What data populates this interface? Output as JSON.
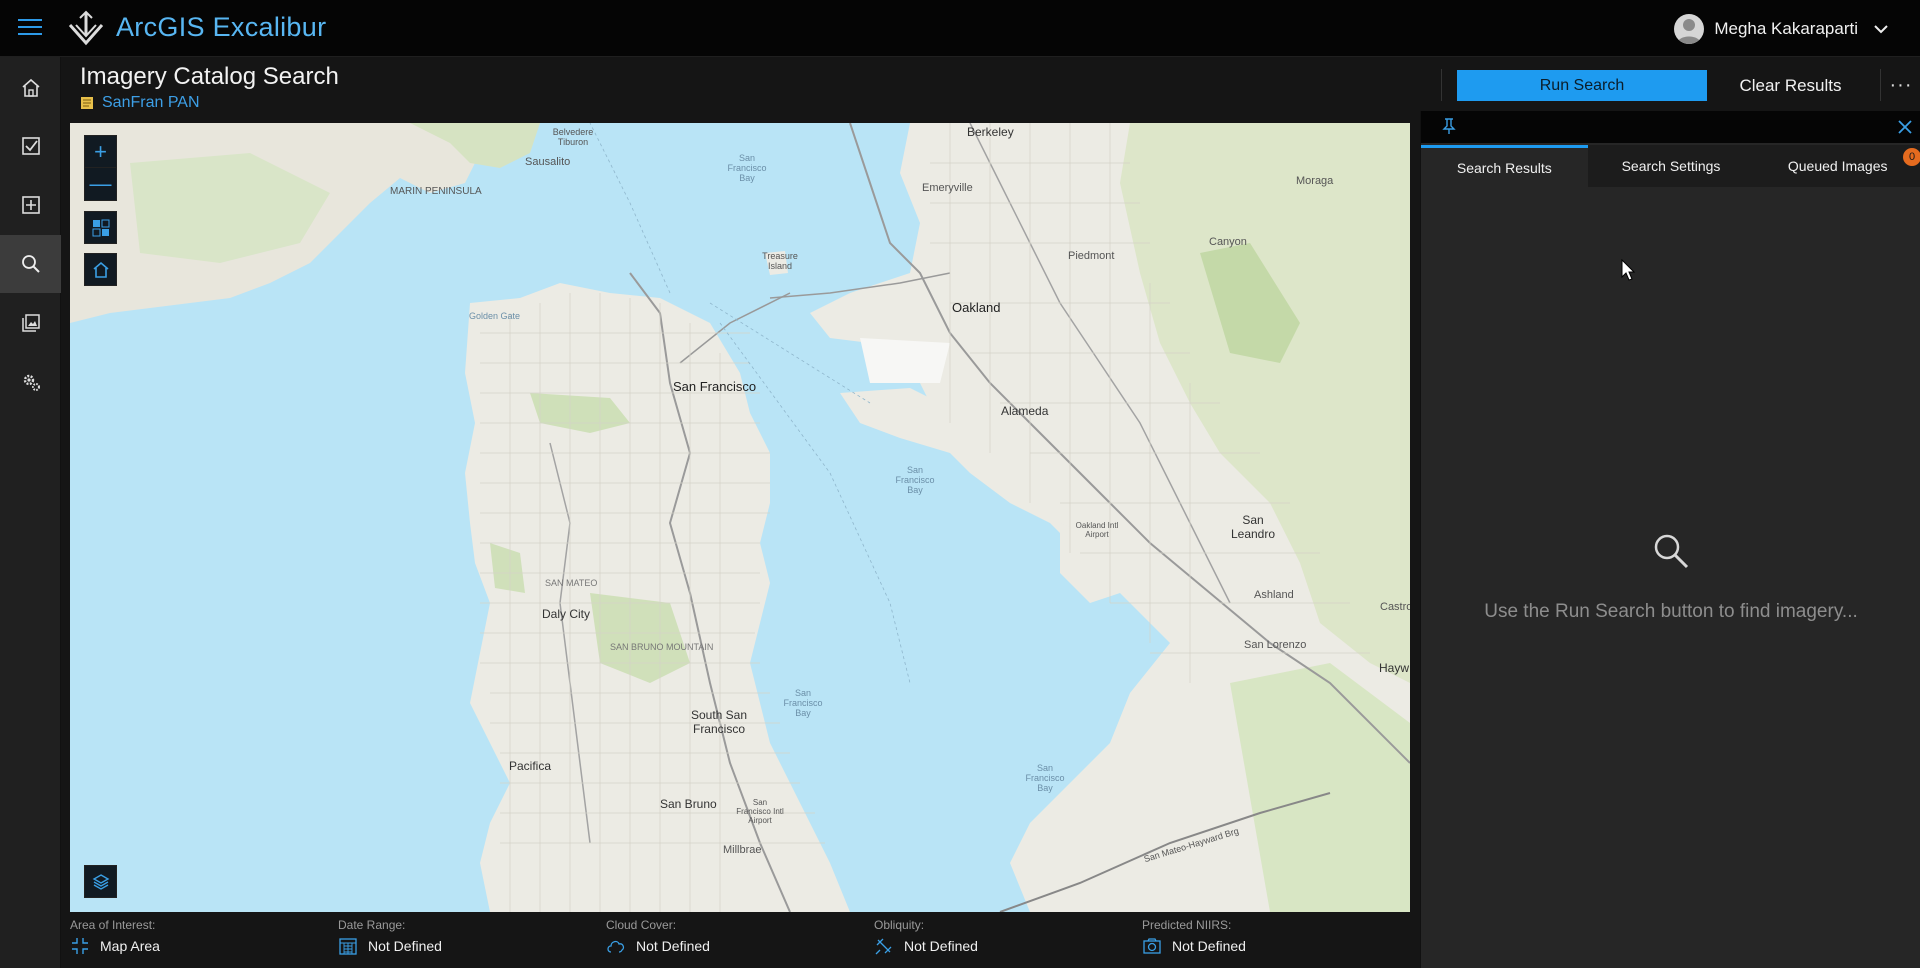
{
  "app": {
    "title": "ArcGIS Excalibur",
    "accent": "#1e9bf0"
  },
  "user": {
    "name": "Megha Kakaraparti"
  },
  "nav": [
    {
      "icon": "home-icon"
    },
    {
      "icon": "checkbox-icon"
    },
    {
      "icon": "add-icon"
    },
    {
      "icon": "search-icon"
    },
    {
      "icon": "image-stack-icon"
    },
    {
      "icon": "settings-icon"
    }
  ],
  "header": {
    "title": "Imagery Catalog Search",
    "project": "SanFran PAN",
    "run_search": "Run Search",
    "clear_results": "Clear Results",
    "more": "···"
  },
  "map": {
    "zoom_in": "+",
    "zoom_out": "—",
    "labels": {
      "berkeley": "Berkeley",
      "oakland": "Oakland",
      "san_francisco": "San Francisco",
      "alameda": "Alameda",
      "daly_city": "Daly City",
      "south_sf": "South San Francisco",
      "san_bruno": "San Bruno",
      "pacifica": "Pacifica",
      "millbrae": "Millbrae",
      "san_leandro": "San Leandro",
      "emeryville": "Emeryville",
      "piedmont": "Piedmont",
      "canyon": "Canyon",
      "moraga": "Moraga",
      "sausalito": "Sausalito",
      "belvedere": "Belvedere Tiburon",
      "marin": "MARIN PENINSULA",
      "golden_gate": "Golden Gate",
      "treasure_island": "Treasure Island",
      "sf_bay_1": "San Francisco Bay",
      "sf_bay_2": "San Francisco Bay",
      "sf_bay_3": "San Francisco Bay",
      "sf_bay_4": "San Francisco Bay",
      "ashland": "Ashland",
      "san_lorenzo": "San Lorenzo",
      "hayward": "Hayw",
      "castro": "Castro",
      "san_bruno_mtn": "SAN BRUNO MOUNTAIN",
      "san_mateo": "SAN MATEO",
      "oakland_airport": "Oakland Intl Airport",
      "sfo": "San Francisco Intl Airport",
      "sm_bridge": "San Mateo-Hayward Brg"
    }
  },
  "filters": [
    {
      "label": "Area of Interest:",
      "value": "Map Area",
      "icon": "aoi-icon"
    },
    {
      "label": "Date Range:",
      "value": "Not Defined",
      "icon": "calendar-icon"
    },
    {
      "label": "Cloud Cover:",
      "value": "Not Defined",
      "icon": "cloud-icon"
    },
    {
      "label": "Obliquity:",
      "value": "Not Defined",
      "icon": "satellite-icon"
    },
    {
      "label": "Predicted NIIRS:",
      "value": "Not Defined",
      "icon": "camera-icon"
    }
  ],
  "panel": {
    "tabs": [
      {
        "label": "Search Results",
        "active": true
      },
      {
        "label": "Search Settings",
        "active": false
      },
      {
        "label": "Queued Images",
        "active": false,
        "badge": "0"
      }
    ],
    "empty_message": "Use the Run Search button to find imagery..."
  }
}
